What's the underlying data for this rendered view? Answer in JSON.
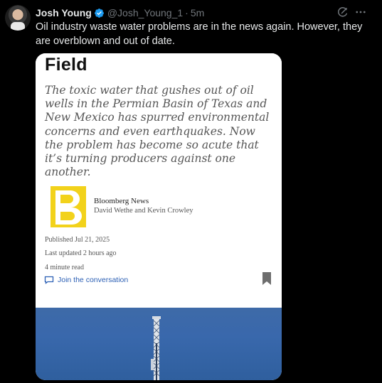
{
  "author": {
    "name": "Josh Young",
    "handle": "@Josh_Young_1",
    "separator": "·",
    "time": "5m",
    "verified": true
  },
  "tweet": {
    "text": "Oil industry waste water problems are in the news again. However, they are overblown and out of date."
  },
  "card": {
    "title": "Field",
    "quote": "The toxic water that gushes out of oil wells in the Permian Basin of Texas and New Mexico has spurred environmental concerns and even earthquakes. Now the problem has become so acute that it’s turning producers against one another.",
    "publication": "Bloomberg News",
    "authors": "David Wethe and Kevin Crowley",
    "published": "Published Jul 21, 2025",
    "last_updated": "Last updated 2 hours ago",
    "read_time": "4 minute read",
    "join_label": "Join the conversation",
    "logo_letter": "B"
  },
  "colors": {
    "background": "#000000",
    "verified_blue": "#1d9bf0",
    "muted_text": "#71767b",
    "link_blue": "#2b5fb4",
    "logo_yellow": "#f2d21b",
    "sky_blue": "#3968ac"
  },
  "icons": {
    "grok": "grok-icon",
    "more": "more-icon",
    "verified": "verified-badge-icon",
    "chat": "chat-bubble-icon",
    "bookmark": "bookmark-icon"
  }
}
